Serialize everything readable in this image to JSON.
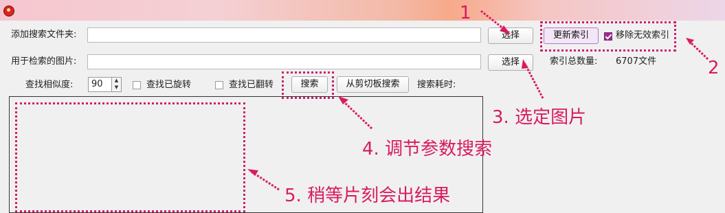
{
  "window": {
    "icon": "bug-icon"
  },
  "row1": {
    "label": "添加搜索文件夹:",
    "input_value": "",
    "select_btn": "选择"
  },
  "row2": {
    "label": "用于检索的图片:",
    "input_value": "",
    "select_btn": "选择"
  },
  "index_panel": {
    "update_btn": "更新索引",
    "remove_invalid_label": "移除无效索引",
    "remove_invalid_checked": true,
    "count_label": "索引总数量:",
    "count_value": "6707文件"
  },
  "row3": {
    "similarity_label": "查找相似度:",
    "similarity_value": "90",
    "rotated_label": "查找已旋转",
    "rotated_checked": false,
    "flipped_label": "查找已翻转",
    "flipped_checked": false,
    "search_btn": "搜索",
    "clipboard_btn": "从剪切板搜索",
    "time_label": "搜索耗时:"
  },
  "annotations": {
    "n1": "1",
    "n2": "2",
    "step3": "3. 选定图片",
    "step4": "4. 调节参数搜索",
    "step5": "5. 稍等片刻会出结果",
    "color": "#d81b60"
  }
}
